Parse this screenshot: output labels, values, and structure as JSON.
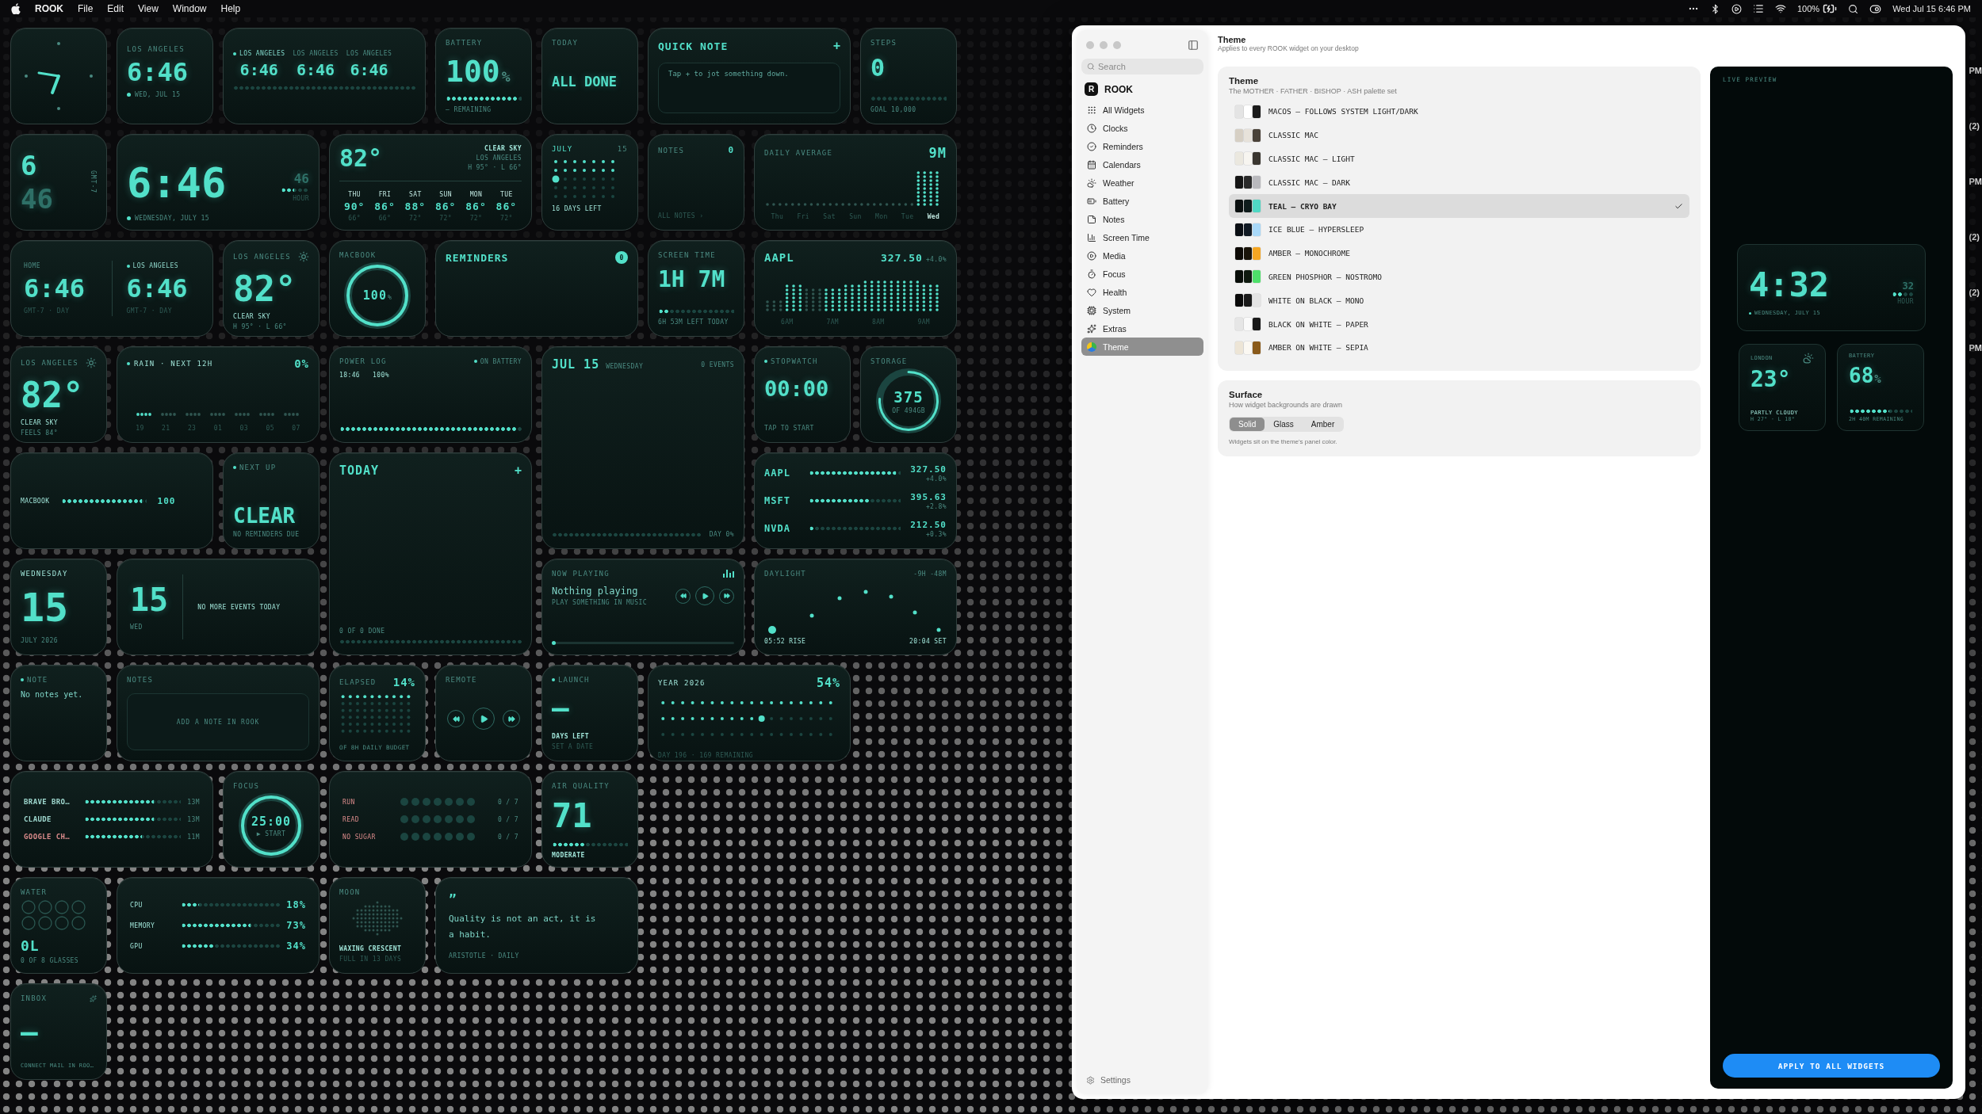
{
  "menubar": {
    "app": "ROOK",
    "menus": [
      "File",
      "Edit",
      "View",
      "Window",
      "Help"
    ],
    "battery": "100%",
    "clock": "Wed Jul 15  6:46 PM"
  },
  "widgets": [
    {
      "kind": "analog_clock"
    },
    {
      "kind": "city_clock",
      "city": "LOS ANGELES",
      "time": "6:46",
      "date": "WED, JUL 15"
    },
    {
      "kind": "world_clocks",
      "clocks": [
        {
          "city": "LOS ANGELES",
          "time": "6:46",
          "local": true
        },
        {
          "city": "LOS ANGELES",
          "time": "6:46",
          "local": false
        },
        {
          "city": "LOS ANGELES",
          "time": "6:46",
          "local": false
        }
      ]
    },
    {
      "kind": "battery",
      "label": "BATTERY",
      "value": "100",
      "unit": "%",
      "level": 1,
      "caption": "— REMAINING"
    },
    {
      "kind": "today_status",
      "label": "TODAY",
      "value": "ALL DONE"
    },
    {
      "kind": "quick_note",
      "title": "QUICK NOTE",
      "add": "+",
      "placeholder": "Tap + to jot something down."
    },
    {
      "kind": "steps",
      "label": "STEPS",
      "value": "0",
      "caption": "GOAL 10,000"
    },
    {
      "kind": "stacked_time",
      "hour": "6",
      "minute": "46",
      "zone": "GMT-7"
    },
    {
      "kind": "big_clock",
      "time": "6:46",
      "date": "WEDNESDAY, JULY 15",
      "seconds": "46",
      "seconds_label": "HOUR",
      "level": 0.55
    },
    {
      "kind": "forecast",
      "temp": "82°",
      "condition": "CLEAR SKY",
      "city": "LOS ANGELES",
      "range": "H 95° · L 66°",
      "days": [
        {
          "day": "THU",
          "high": "90°",
          "low": "66°"
        },
        {
          "day": "FRI",
          "high": "86°",
          "low": "66°"
        },
        {
          "day": "SAT",
          "high": "88°",
          "low": "72°"
        },
        {
          "day": "SUN",
          "high": "86°",
          "low": "72°"
        },
        {
          "day": "MON",
          "high": "86°",
          "low": "72°"
        },
        {
          "day": "TUE",
          "high": "86°",
          "low": "72°"
        }
      ]
    },
    {
      "kind": "month_dots",
      "month": "JULY",
      "day": "15",
      "caption": "16 DAYS LEFT"
    },
    {
      "kind": "notes_count",
      "label": "NOTES",
      "count": "0",
      "link": "ALL NOTES ›"
    },
    {
      "kind": "daily_average",
      "label": "DAILY AVERAGE",
      "value": "9M",
      "days": [
        {
          "day": "Thu",
          "selected": false
        },
        {
          "day": "Fri",
          "selected": false
        },
        {
          "day": "Sat",
          "selected": false
        },
        {
          "day": "Sun",
          "selected": false
        },
        {
          "day": "Mon",
          "selected": false
        },
        {
          "day": "Tue",
          "selected": false
        },
        {
          "day": "Wed",
          "selected": true
        }
      ]
    },
    {
      "kind": "dual_clock",
      "clocks": [
        {
          "label": "HOME",
          "time": "6:46",
          "zone": "GMT-7 · DAY",
          "local": false
        },
        {
          "label": "LOS ANGELES",
          "time": "6:46",
          "zone": "GMT-7 · DAY",
          "local": true
        }
      ]
    },
    {
      "kind": "weather",
      "city": "LOS ANGELES",
      "temp": "82°",
      "condition": "CLEAR SKY",
      "detail": "H 95° · L 66°"
    },
    {
      "kind": "ring",
      "label": "MACBOOK",
      "value": "100",
      "unit": "%"
    },
    {
      "kind": "reminders",
      "title": "REMINDERS",
      "count": "0"
    },
    {
      "kind": "screen_time",
      "label": "SCREEN TIME",
      "value": "1H 7M",
      "level": 0.12,
      "caption": "6H 53M LEFT TODAY"
    },
    {
      "kind": "stock_chart",
      "symbol": "AAPL",
      "price": "327.50",
      "change": "+4.0%",
      "hours": [
        "6AM",
        "7AM",
        "8AM",
        "9AM"
      ]
    },
    {
      "kind": "weather",
      "city": "LOS ANGELES",
      "temp": "82°",
      "condition": "CLEAR SKY",
      "detail": "FEELS 84°"
    },
    {
      "kind": "rain",
      "title": "RAIN · NEXT 12H",
      "value": "0%",
      "hours": [
        "19",
        "21",
        "23",
        "01",
        "03",
        "05",
        "07"
      ]
    },
    {
      "kind": "power_log",
      "title": "POWER LOG",
      "status": "ON BATTERY",
      "time": "18:46",
      "value": "100%",
      "level": 1
    },
    {
      "kind": "agenda",
      "date": "JUL 15",
      "weekday": "WEDNESDAY",
      "events": "0 EVENTS",
      "caption": "DAY 0%"
    },
    {
      "kind": "stopwatch",
      "label": "STOPWATCH",
      "time": "00:00",
      "caption": "TAP TO START"
    },
    {
      "kind": "storage",
      "label": "STORAGE",
      "value": "375",
      "caption": "OF 494GB"
    },
    {
      "kind": "battery_bar",
      "label": "MACBOOK",
      "value": "100",
      "level": 1
    },
    {
      "kind": "next_up",
      "label": "NEXT UP",
      "value": "CLEAR",
      "caption": "NO REMINDERS DUE"
    },
    {
      "kind": "todo",
      "title": "TODAY",
      "add": "+",
      "caption": "0 OF 0 DONE"
    },
    {
      "kind": "stocks",
      "rows": [
        {
          "symbol": "AAPL",
          "price": "327.50",
          "change": "+4.0%",
          "level": 1
        },
        {
          "symbol": "MSFT",
          "price": "395.63",
          "change": "+2.8%",
          "level": 0.7
        },
        {
          "symbol": "NVDA",
          "price": "212.50",
          "change": "+0.3%",
          "level": 0.05
        }
      ]
    },
    {
      "kind": "date",
      "weekday": "WEDNESDAY",
      "day": "15",
      "caption": "JULY 2026"
    },
    {
      "kind": "day_events",
      "day": "15",
      "weekday": "WED",
      "message": "NO MORE EVENTS TODAY"
    },
    {
      "kind": "now_playing",
      "label": "NOW PLAYING",
      "title": "Nothing playing",
      "subtitle": "PLAY SOMETHING IN MUSIC",
      "level": 0.01
    },
    {
      "kind": "daylight",
      "label": "DAYLIGHT",
      "remaining": "-9H -48M",
      "rise": "05:52 RISE",
      "set": "20:04 SET"
    },
    {
      "kind": "note",
      "label": "NOTE",
      "text": "No notes yet."
    },
    {
      "kind": "notes_add",
      "label": "NOTES",
      "action": "ADD A NOTE IN ROOK"
    },
    {
      "kind": "elapsed",
      "label": "ELAPSED",
      "value": "14%",
      "caption": "OF 8H DAILY BUDGET"
    },
    {
      "kind": "remote",
      "label": "REMOTE"
    },
    {
      "kind": "launch",
      "label": "LAUNCH",
      "value": "—",
      "caption": "DAYS LEFT",
      "sub": "SET A DATE"
    },
    {
      "kind": "year",
      "label": "YEAR 2026",
      "value": "54%",
      "caption": "DAY 196 · 169 REMAINING"
    },
    {
      "kind": "app_usage",
      "rows": [
        {
          "name": "BRAVE BRO…",
          "value": "13M",
          "level": 0.75,
          "color": "#9fd8cf"
        },
        {
          "name": "CLAUDE",
          "value": "13M",
          "level": 0.75,
          "color": "#9fd8cf"
        },
        {
          "name": "GOOGLE CH…",
          "value": "11M",
          "level": 0.62,
          "color": "#d98a8a"
        }
      ]
    },
    {
      "kind": "focus",
      "label": "FOCUS",
      "time": "25:00",
      "action": "▶ START"
    },
    {
      "kind": "habits",
      "rows": [
        {
          "name": "RUN",
          "count": "0 / 7"
        },
        {
          "name": "READ",
          "count": "0 / 7"
        },
        {
          "name": "NO SUGAR",
          "count": "0 / 7"
        }
      ]
    },
    {
      "kind": "air_quality",
      "label": "AIR QUALITY",
      "value": "71",
      "caption": "MODERATE",
      "level": 0.45
    },
    {
      "kind": "water",
      "label": "WATER",
      "value": "0L",
      "caption": "0 OF 8 GLASSES"
    },
    {
      "kind": "system",
      "rows": [
        {
          "name": "CPU",
          "value": "18%",
          "level": 0.18
        },
        {
          "name": "MEMORY",
          "value": "73%",
          "level": 0.73
        },
        {
          "name": "GPU",
          "value": "34%",
          "level": 0.34
        }
      ]
    },
    {
      "kind": "moon",
      "label": "MOON",
      "phase": "WAXING CRESCENT",
      "caption": "FULL IN 13 DAYS"
    },
    {
      "kind": "quote",
      "mark": "”",
      "text": "Quality is not an act, it is a habit.",
      "source": "ARISTOTLE · DAILY"
    },
    {
      "kind": "inbox",
      "label": "INBOX",
      "value": "—",
      "caption": "CONNECT MAIL IN ROO…"
    }
  ],
  "background_fragments": [
    "PM",
    "(2)",
    "PM",
    "(2)",
    "(2)",
    "PM"
  ],
  "settings": {
    "sidebar": {
      "search": {
        "placeholder": "Search"
      },
      "app": {
        "logo": "R",
        "name": "ROOK"
      },
      "items": [
        {
          "label": "All Widgets",
          "selected": false
        },
        {
          "label": "Clocks",
          "selected": false
        },
        {
          "label": "Reminders",
          "selected": false
        },
        {
          "label": "Calendars",
          "selected": false
        },
        {
          "label": "Weather",
          "selected": false
        },
        {
          "label": "Battery",
          "selected": false
        },
        {
          "label": "Notes",
          "selected": false
        },
        {
          "label": "Screen Time",
          "selected": false
        },
        {
          "label": "Media",
          "selected": false
        },
        {
          "label": "Focus",
          "selected": false
        },
        {
          "label": "Health",
          "selected": false
        },
        {
          "label": "System",
          "selected": false
        },
        {
          "label": "Extras",
          "selected": false
        },
        {
          "label": "Theme",
          "selected": true
        }
      ],
      "footer": "Settings"
    },
    "header": {
      "title": "Theme",
      "subtitle": "Applies to every ROOK widget on your desktop"
    },
    "theme": {
      "title": "Theme",
      "subtitle": "The MOTHER · FATHER · BISHOP · ASH palette set",
      "options": [
        {
          "name": "MACOS — FOLLOWS SYSTEM LIGHT/DARK",
          "swatches": [
            {
              "color": "#e4e4e4"
            },
            {
              "color": "#ffffff"
            },
            {
              "color": "#1c1c1c"
            }
          ],
          "selected": false
        },
        {
          "name": "CLASSIC MAC",
          "swatches": [
            {
              "color": "#d6cfc4"
            },
            {
              "color": "#e7e2da"
            },
            {
              "color": "#4a4238"
            }
          ],
          "selected": false
        },
        {
          "name": "CLASSIC MAC — LIGHT",
          "swatches": [
            {
              "color": "#ebe8df"
            },
            {
              "color": "#f7f5f0"
            },
            {
              "color": "#3a3630"
            }
          ],
          "selected": false
        },
        {
          "name": "CLASSIC MAC — DARK",
          "swatches": [
            {
              "color": "#151515"
            },
            {
              "color": "#2a2a2a"
            },
            {
              "color": "#b9b9bd"
            }
          ],
          "selected": false
        },
        {
          "name": "TEAL — CRYO BAY",
          "swatches": [
            {
              "color": "#0a0f0f"
            },
            {
              "color": "#0f1c1c"
            },
            {
              "color": "#4fd8c4"
            }
          ],
          "selected": true
        },
        {
          "name": "ICE BLUE — HYPERSLEEP",
          "swatches": [
            {
              "color": "#0a0e14"
            },
            {
              "color": "#111a24"
            },
            {
              "color": "#a8d8f8"
            }
          ],
          "selected": false
        },
        {
          "name": "AMBER — MONOCHROME",
          "swatches": [
            {
              "color": "#0d0a06"
            },
            {
              "color": "#1a140a"
            },
            {
              "color": "#f5a623"
            }
          ],
          "selected": false
        },
        {
          "name": "GREEN PHOSPHOR — NOSTROMO",
          "swatches": [
            {
              "color": "#080d08"
            },
            {
              "color": "#0f1a0f"
            },
            {
              "color": "#4ee06a"
            }
          ],
          "selected": false
        },
        {
          "name": "WHITE ON BLACK — MONO",
          "swatches": [
            {
              "color": "#0a0a0a"
            },
            {
              "color": "#1a1a1a"
            },
            {
              "color": "#e4e4e4"
            }
          ],
          "selected": false
        },
        {
          "name": "BLACK ON WHITE — PAPER",
          "swatches": [
            {
              "color": "#e6e6e6"
            },
            {
              "color": "#fafafa"
            },
            {
              "color": "#1a1a1a"
            }
          ],
          "selected": false
        },
        {
          "name": "AMBER ON WHITE — SEPIA",
          "swatches": [
            {
              "color": "#ede5d6"
            },
            {
              "color": "#fbf8f2"
            },
            {
              "color": "#8a5a1a"
            }
          ],
          "selected": false
        }
      ]
    },
    "surface": {
      "title": "Surface",
      "subtitle": "How widget backgrounds are drawn",
      "segments": [
        {
          "label": "Solid",
          "selected": true
        },
        {
          "label": "Glass",
          "selected": false
        },
        {
          "label": "Amber",
          "selected": false
        }
      ],
      "note": "Widgets sit on the theme's panel color."
    },
    "preview": {
      "label": "LIVE PREVIEW",
      "clock": {
        "time": "4:32",
        "seconds": "32",
        "seconds_label": "HOUR",
        "date": "WEDNESDAY, JULY 15"
      },
      "weather": {
        "city": "LONDON",
        "temp": "23°",
        "condition": "PARTLY CLOUDY",
        "detail": "H 27° · L 18°"
      },
      "battery": {
        "label": "BATTERY",
        "value": "68",
        "unit": "%",
        "caption": "2H 40M REMAINING",
        "level": 0.68
      },
      "button": "APPLY TO ALL WIDGETS"
    }
  }
}
